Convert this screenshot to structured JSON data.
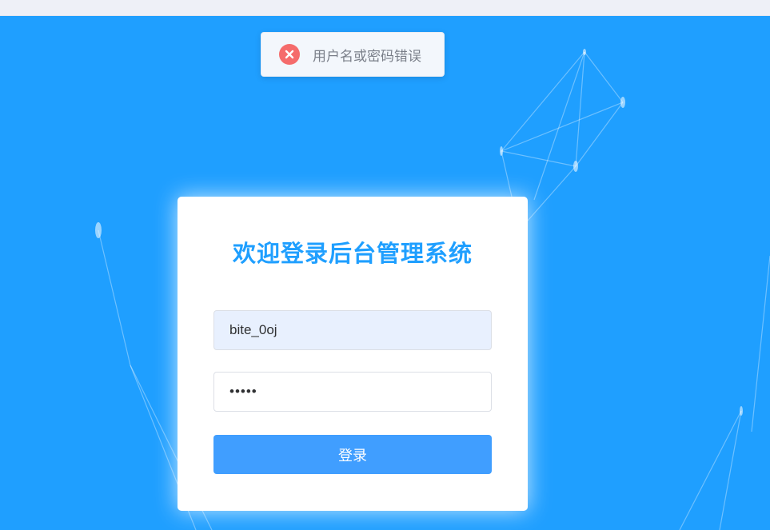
{
  "toast": {
    "type": "error",
    "icon": "error-circle-icon",
    "message": "用户名或密码错误"
  },
  "login": {
    "title": "欢迎登录后台管理系统",
    "username_value": "bite_0oj",
    "password_value": "•••••",
    "submit_label": "登录"
  },
  "colors": {
    "background": "#1f9fff",
    "title": "#1f9fff",
    "button": "#409eff",
    "error": "#f56c6c",
    "username_fill": "#e8f0fe"
  }
}
